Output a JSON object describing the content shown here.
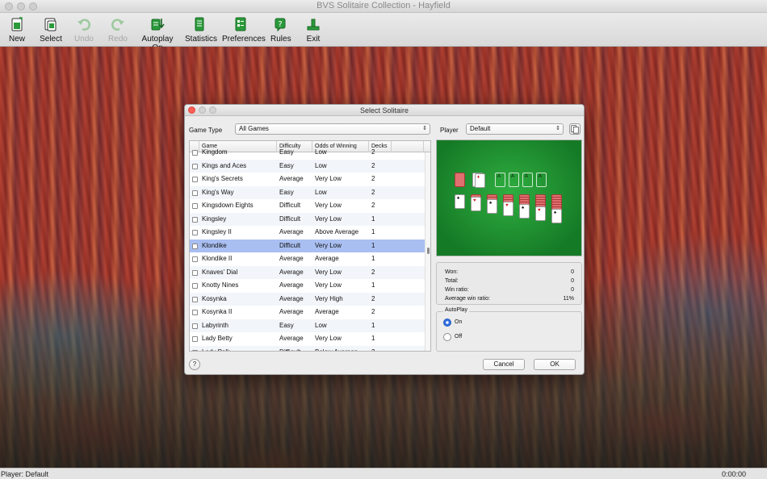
{
  "window": {
    "title": "BVS Solitaire Collection  -  Hayfield"
  },
  "toolbar": [
    {
      "label": "New",
      "icon": "new-game-icon",
      "enabled": true
    },
    {
      "label": "Select",
      "icon": "select-game-icon",
      "enabled": true
    },
    {
      "label": "Undo",
      "icon": "undo-icon",
      "enabled": false
    },
    {
      "label": "Redo",
      "icon": "redo-icon",
      "enabled": false
    },
    {
      "label": "Autoplay On",
      "icon": "autoplay-icon",
      "enabled": true
    },
    {
      "label": "Statistics",
      "icon": "statistics-icon",
      "enabled": true
    },
    {
      "label": "Preferences",
      "icon": "preferences-icon",
      "enabled": true
    },
    {
      "label": "Rules",
      "icon": "rules-icon",
      "enabled": true
    },
    {
      "label": "Exit",
      "icon": "exit-icon",
      "enabled": true
    }
  ],
  "status": {
    "player": "Player: Default",
    "time": "0:00:00"
  },
  "dialog": {
    "title": "Select Solitaire",
    "game_type_label": "Game Type",
    "game_type_value": "All Games",
    "player_label": "Player",
    "player_value": "Default",
    "columns": [
      "Game",
      "Difficulty",
      "Odds of Winning",
      "Decks"
    ],
    "rows": [
      {
        "game": "Kingdom",
        "difficulty": "Easy",
        "odds": "Low",
        "decks": "2",
        "selected": false
      },
      {
        "game": "Kings and Aces",
        "difficulty": "Easy",
        "odds": "Low",
        "decks": "2",
        "selected": false
      },
      {
        "game": "King's Secrets",
        "difficulty": "Average",
        "odds": "Very Low",
        "decks": "2",
        "selected": false
      },
      {
        "game": "King's Way",
        "difficulty": "Easy",
        "odds": "Low",
        "decks": "2",
        "selected": false
      },
      {
        "game": "Kingsdown Eights",
        "difficulty": "Difficult",
        "odds": "Very Low",
        "decks": "2",
        "selected": false
      },
      {
        "game": "Kingsley",
        "difficulty": "Difficult",
        "odds": "Very Low",
        "decks": "1",
        "selected": false
      },
      {
        "game": "Kingsley II",
        "difficulty": "Average",
        "odds": "Above Average",
        "decks": "1",
        "selected": false
      },
      {
        "game": "Klondike",
        "difficulty": "Difficult",
        "odds": "Very Low",
        "decks": "1",
        "selected": true
      },
      {
        "game": "Klondike II",
        "difficulty": "Average",
        "odds": "Average",
        "decks": "1",
        "selected": false
      },
      {
        "game": "Knaves' Dial",
        "difficulty": "Average",
        "odds": "Very Low",
        "decks": "2",
        "selected": false
      },
      {
        "game": "Knotty Nines",
        "difficulty": "Average",
        "odds": "Very Low",
        "decks": "1",
        "selected": false
      },
      {
        "game": "Kosynka",
        "difficulty": "Average",
        "odds": "Very High",
        "decks": "2",
        "selected": false
      },
      {
        "game": "Kosynka II",
        "difficulty": "Average",
        "odds": "Average",
        "decks": "2",
        "selected": false
      },
      {
        "game": "Labyrinth",
        "difficulty": "Easy",
        "odds": "Low",
        "decks": "1",
        "selected": false
      },
      {
        "game": "Lady Betty",
        "difficulty": "Average",
        "odds": "Very Low",
        "decks": "1",
        "selected": false
      },
      {
        "game": "Lady Palk",
        "difficulty": "Difficult",
        "odds": "Below Average",
        "decks": "2",
        "selected": false
      }
    ],
    "stats": [
      {
        "label": "Won:",
        "value": "0"
      },
      {
        "label": "Total:",
        "value": "0"
      },
      {
        "label": "Win ratio:",
        "value": "0"
      },
      {
        "label": "Average win ratio:",
        "value": "11%"
      }
    ],
    "autoplay": {
      "title": "AutoPlay",
      "on_label": "On",
      "off_label": "Off",
      "selected": "On"
    },
    "help_label": "?",
    "cancel_label": "Cancel",
    "ok_label": "OK",
    "colors": {
      "selection": "#a9bff2",
      "felt": "#1e8f30"
    }
  }
}
